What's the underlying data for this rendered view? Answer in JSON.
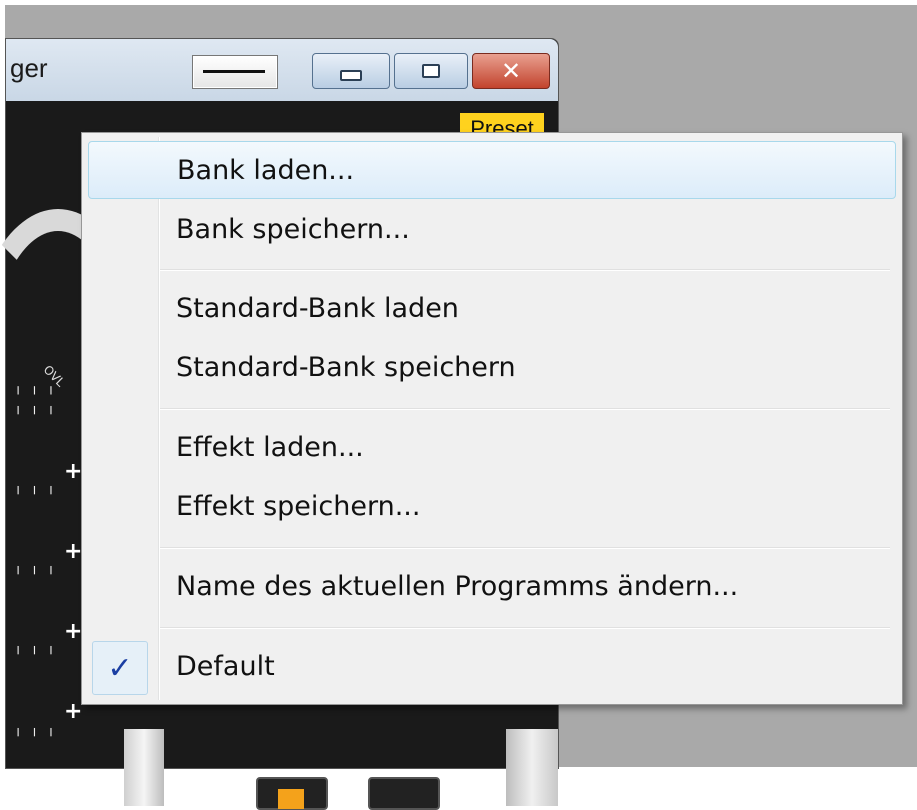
{
  "window": {
    "title_fragment": "ger",
    "preset_label": "Preset",
    "minimize_glyph": "",
    "maximize_glyph": "",
    "close_glyph": "✕"
  },
  "plugin": {
    "ovl_label": "OVL",
    "plus_symbol": "+"
  },
  "menu": {
    "items": [
      {
        "label": "Bank laden..."
      },
      {
        "label": "Bank speichern..."
      },
      {
        "label": "Standard-Bank laden"
      },
      {
        "label": "Standard-Bank speichern"
      },
      {
        "label": "Effekt laden..."
      },
      {
        "label": "Effekt speichern..."
      },
      {
        "label": "Name des aktuellen Programms ändern..."
      },
      {
        "label": "Default",
        "checked": true,
        "check_glyph": "✓"
      }
    ]
  },
  "colors": {
    "highlight_border": "#a8d8eb",
    "preset_bg": "#ffd21e",
    "check": "#1b3fa3"
  }
}
